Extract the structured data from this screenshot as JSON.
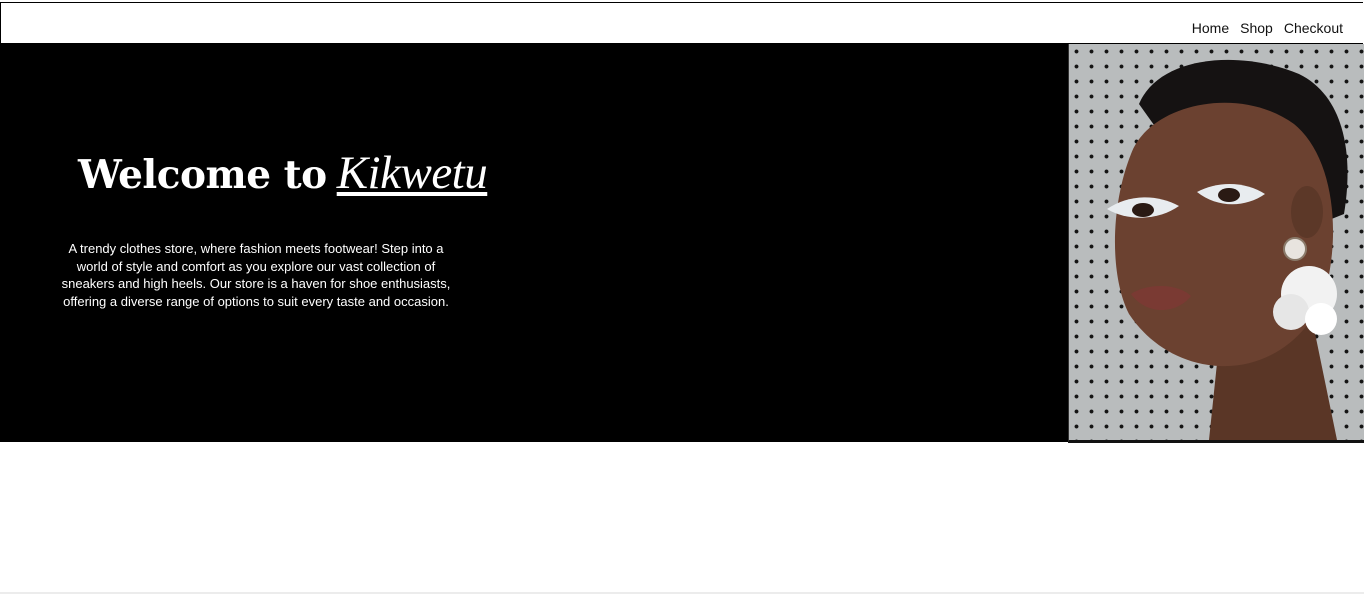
{
  "nav": {
    "links": [
      "Home",
      "Shop",
      "Checkout"
    ]
  },
  "hero": {
    "welcome": "Welcome to",
    "brand": "Kikwetu",
    "description": "A trendy clothes store, where fashion meets footwear! Step into a world of style and comfort as you explore our vast collection of sneakers and high heels. Our store is a haven for shoe enthusiasts, offering a diverse range of options to suit every taste and occasion."
  },
  "colors": {
    "hero_background": "#000000",
    "hero_text": "#ffffff",
    "nav_text": "#111111"
  }
}
